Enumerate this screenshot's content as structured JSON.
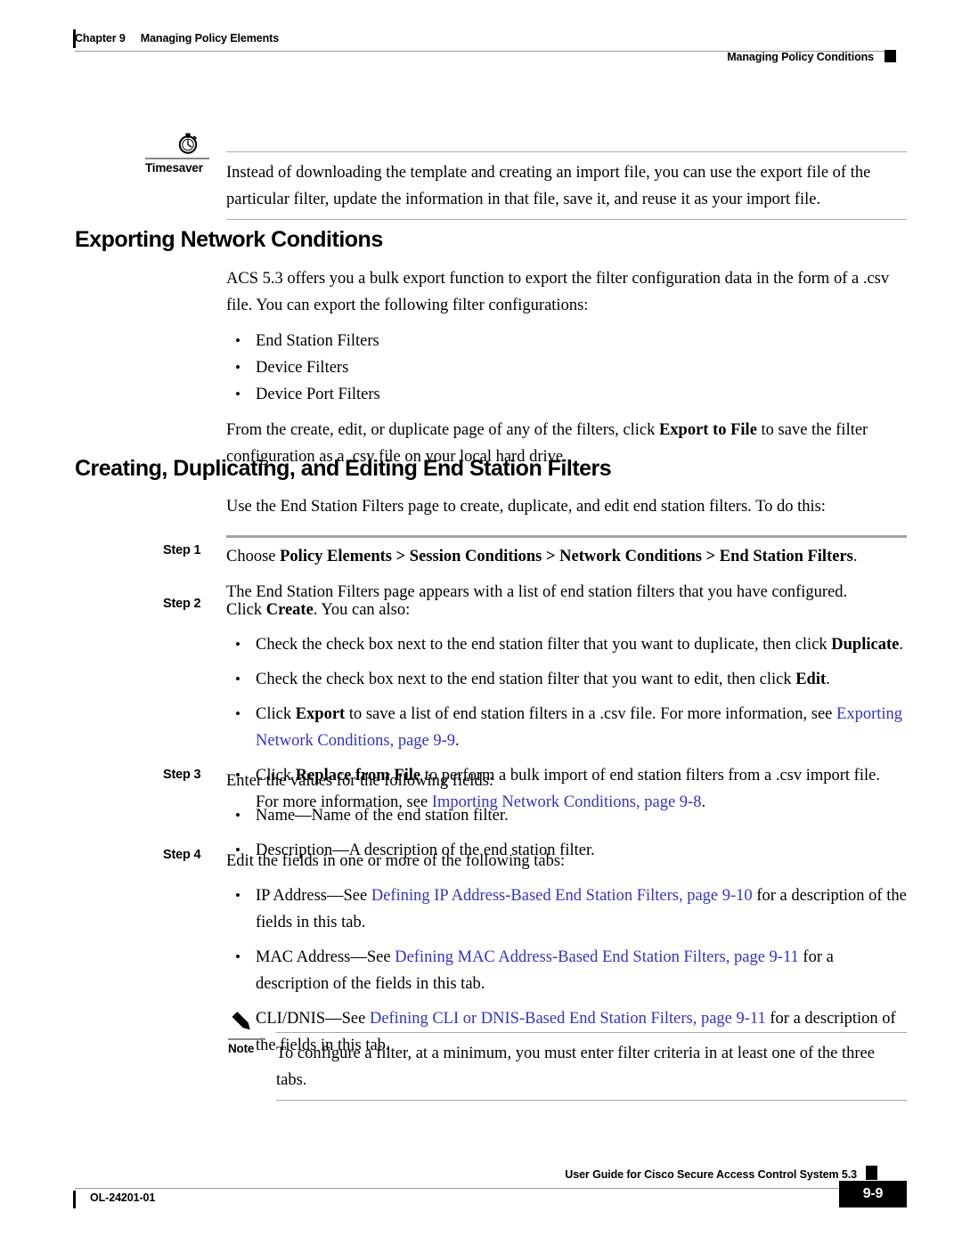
{
  "header": {
    "chapter": "Chapter 9",
    "chapter_title": "Managing Policy Elements",
    "running_head": "Managing Policy Conditions"
  },
  "timesaver": {
    "icon": "stopwatch-icon",
    "label": "Timesaver",
    "text": "Instead of downloading the template and creating an import file, you can use the export file of the particular filter, update the information in that file, save it, and reuse it as your import file."
  },
  "section1": {
    "heading": "Exporting Network Conditions",
    "intro": "ACS 5.3 offers you a bulk export function to export the filter configuration data in the form of a .csv file. You can export the following filter configurations:",
    "bullets": [
      "End Station Filters",
      "Device Filters",
      "Device Port Filters"
    ],
    "closing_a": "From the create, edit, or duplicate page of any of the filters, click ",
    "closing_bold": "Export to File",
    "closing_b": " to save the filter configuration as a .csv file on your local hard drive."
  },
  "section2": {
    "heading": "Creating, Duplicating, and Editing End Station Filters",
    "intro": "Use the End Station Filters page to create, duplicate, and edit end station filters. To do this:",
    "steps": [
      {
        "label": "Step 1",
        "lead": "Choose ",
        "bold": "Policy Elements > Session Conditions > Network Conditions > End Station Filters",
        "tail": ".",
        "result": "The End Station Filters page appears with a list of end station filters that you have configured."
      },
      {
        "label": "Step 2",
        "lead": "Click ",
        "bold": "Create",
        "tail": ". You can also:",
        "bullets": [
          {
            "pre": "Check the check box next to the end station filter that you want to duplicate, then click ",
            "bold": "Duplicate",
            "post": "."
          },
          {
            "pre": "Check the check box next to the end station filter that you want to edit, then click ",
            "bold": "Edit",
            "post": "."
          },
          {
            "pre": "Click ",
            "bold": "Export",
            "post": " to save a list of end station filters in a .csv file. For more information, see ",
            "link": "Exporting Network Conditions, page 9-9",
            "after": "."
          },
          {
            "pre": "Click ",
            "bold": "Replace from File",
            "post": " to perform a bulk import of end station filters from a .csv import file. For more information, see ",
            "link": "Importing Network Conditions, page 9-8",
            "after": "."
          }
        ]
      },
      {
        "label": "Step 3",
        "lead": "Enter the values for the following fields:",
        "bold": "",
        "tail": "",
        "bullets": [
          {
            "pre": "Name—Name of the end station filter.",
            "bold": "",
            "post": ""
          },
          {
            "pre": "Description—A description of the end station filter.",
            "bold": "",
            "post": ""
          }
        ]
      },
      {
        "label": "Step 4",
        "lead": "Edit the fields in one or more of the following tabs:",
        "bold": "",
        "tail": "",
        "bullets": [
          {
            "pre": "IP Address—See ",
            "bold": "",
            "post": "",
            "link": "Defining IP Address-Based End Station Filters, page 9-10",
            "after": " for a description of the fields in this tab."
          },
          {
            "pre": "MAC Address—See ",
            "bold": "",
            "post": "",
            "link": "Defining MAC Address-Based End Station Filters, page 9-11",
            "after": " for a description of the fields in this tab."
          },
          {
            "pre": "CLI/DNIS—See ",
            "bold": "",
            "post": "",
            "link": "Defining CLI or DNIS-Based End Station Filters, page 9-11",
            "after": " for a description of the fields in this tab."
          }
        ]
      }
    ]
  },
  "note": {
    "icon": "pencil-icon",
    "label": "Note",
    "text": "To configure a filter, at a minimum, you must enter filter criteria in at least one of the three tabs."
  },
  "footer": {
    "doc_id": "OL-24201-01",
    "guide_title": "User Guide for Cisco Secure Access Control System 5.3",
    "page_number": "9-9"
  },
  "colors": {
    "link": "#3333cc",
    "rule": "#9b9b9b",
    "text": "#000000"
  }
}
